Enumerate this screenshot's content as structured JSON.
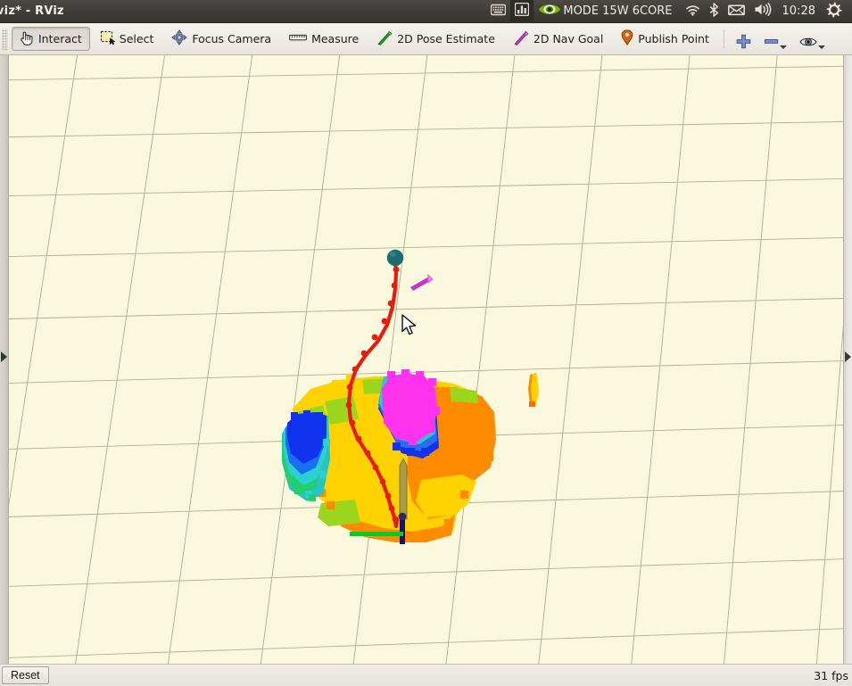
{
  "window": {
    "title": "viz* - RViz"
  },
  "systray": {
    "items": [
      {
        "name": "onscreen-keyboard-icon",
        "icon": "keyboard-icon",
        "label": ""
      },
      {
        "name": "system-monitor-icon",
        "icon": "bar-chart-icon",
        "label": "",
        "active": true
      },
      {
        "name": "nvidia-power-mode",
        "icon": "nvidia-logo-icon",
        "label": "MODE 15W 6CORE"
      },
      {
        "name": "network-icon",
        "icon": "wifi-icon",
        "label": ""
      },
      {
        "name": "bluetooth-icon",
        "icon": "bluetooth-icon",
        "label": ""
      },
      {
        "name": "mail-icon",
        "icon": "envelope-icon",
        "label": ""
      },
      {
        "name": "volume-icon",
        "icon": "speaker-icon",
        "label": ""
      }
    ],
    "clock": "10:28",
    "settings_icon": "gear-icon"
  },
  "toolbar": {
    "tools": [
      {
        "label": "Interact",
        "icon": "hand-cursor-icon",
        "active": true
      },
      {
        "label": "Select",
        "icon": "dashed-rect-icon",
        "active": false
      },
      {
        "label": "Focus Camera",
        "icon": "four-way-arrow-icon",
        "active": false
      },
      {
        "label": "Measure",
        "icon": "ruler-icon",
        "active": false
      },
      {
        "label": "2D Pose Estimate",
        "icon": "green-arrow-icon",
        "active": false
      },
      {
        "label": "2D Nav Goal",
        "icon": "magenta-arrow-icon",
        "active": false
      },
      {
        "label": "Publish Point",
        "icon": "map-pin-icon",
        "active": false
      }
    ],
    "add_tool_icon": "plus-icon",
    "remove_tool_icon": "minus-icon",
    "visibility_icon": "eye-icon"
  },
  "statusbar": {
    "reset_label": "Reset",
    "fps": "31 fps"
  },
  "viewport": {
    "background_color": "#fbf9dd",
    "grid_color": "#9a9a82",
    "colors": {
      "path": "#e81c0c",
      "goal_marker": "#1d6b6e",
      "nav_goal_arrow": "#cc33cc",
      "axis_x": "#9a8f44",
      "axis_y": "#00cc22",
      "axis_z": "#15156b",
      "voxel_magenta": "#ff33ee",
      "voxel_blue": "#1133ee",
      "voxel_cyan": "#22c8c8",
      "voxel_green": "#8fd616",
      "voxel_yellow": "#ffd200",
      "voxel_orange": "#ff8c00"
    }
  }
}
